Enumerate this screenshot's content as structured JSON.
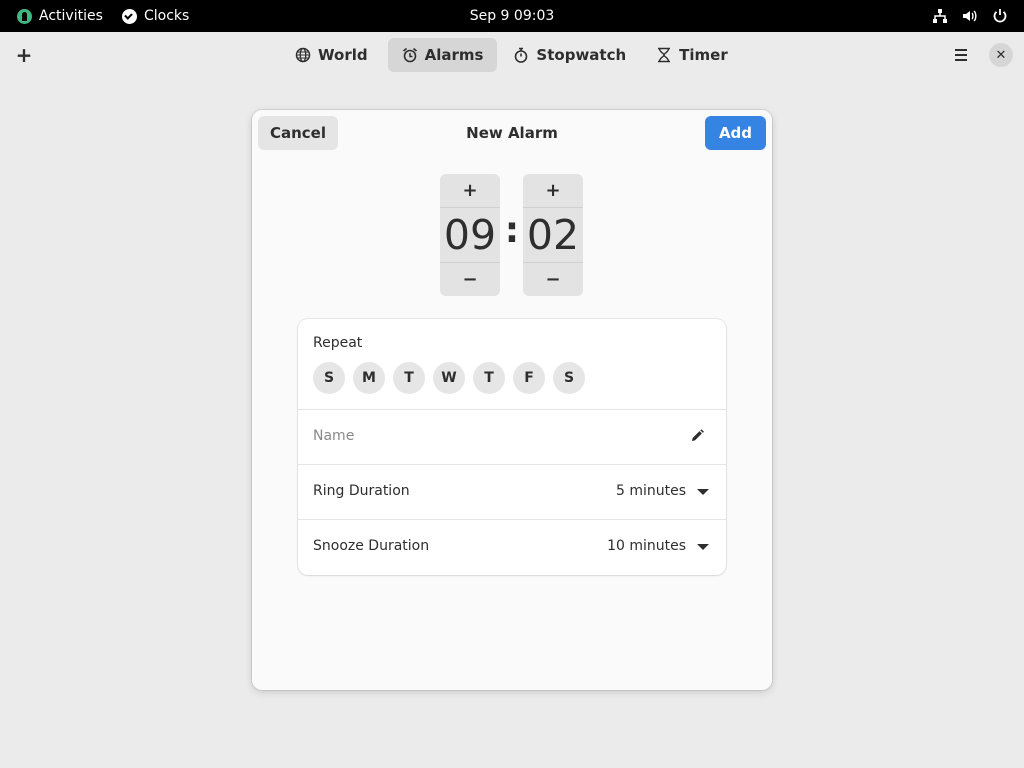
{
  "topbar": {
    "activities": "Activities",
    "app_name": "Clocks",
    "datetime": "Sep 9  09:03",
    "icons": [
      "network-icon",
      "volume-icon",
      "power-icon"
    ]
  },
  "headerbar": {
    "new_icon": "+",
    "tabs": [
      {
        "label": "World",
        "icon": "globe-icon",
        "active": false
      },
      {
        "label": "Alarms",
        "icon": "alarm-icon",
        "active": true
      },
      {
        "label": "Stopwatch",
        "icon": "stopwatch-icon",
        "active": false
      },
      {
        "label": "Timer",
        "icon": "hourglass-icon",
        "active": false
      }
    ],
    "close_glyph": "✕"
  },
  "dialog": {
    "cancel_label": "Cancel",
    "title": "New Alarm",
    "add_label": "Add",
    "hours": {
      "up": "+",
      "value": "09",
      "down": "−"
    },
    "minutes": {
      "up": "+",
      "value": "02",
      "down": "−"
    },
    "separator": ":",
    "repeat": {
      "label": "Repeat",
      "days": [
        "S",
        "M",
        "T",
        "W",
        "T",
        "F",
        "S"
      ]
    },
    "name_placeholder": "Name",
    "ring_duration": {
      "label": "Ring Duration",
      "value": "5 minutes"
    },
    "snooze_duration": {
      "label": "Snooze Duration",
      "value": "10 minutes"
    }
  },
  "colors": {
    "accent": "#3584e4",
    "topbar_bg": "#000000",
    "window_bg": "#ebebeb"
  }
}
